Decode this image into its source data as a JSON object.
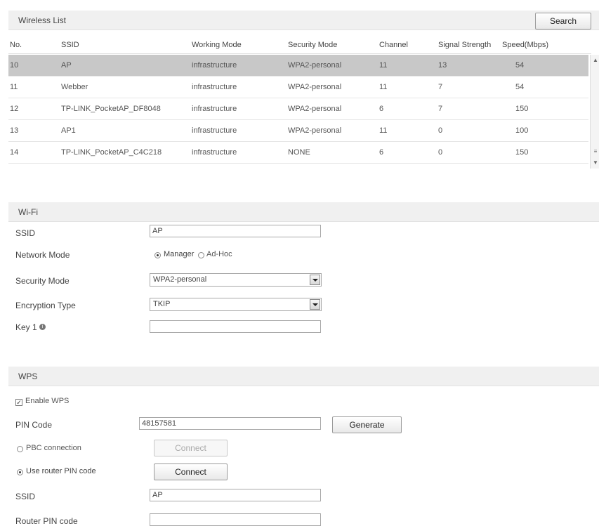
{
  "wireless_list": {
    "title": "Wireless List",
    "search_label": "Search",
    "columns": [
      "No.",
      "SSID",
      "Working Mode",
      "Security Mode",
      "Channel",
      "Signal Strength",
      "Speed(Mbps)"
    ],
    "rows": [
      [
        "10",
        "AP",
        "infrastructure",
        "WPA2-personal",
        "11",
        "13",
        "54"
      ],
      [
        "11",
        "Webber",
        "infrastructure",
        "WPA2-personal",
        "11",
        "7",
        "54"
      ],
      [
        "12",
        "TP-LINK_PocketAP_DF8048",
        "infrastructure",
        "WPA2-personal",
        "6",
        "7",
        "150"
      ],
      [
        "13",
        "AP1",
        "infrastructure",
        "WPA2-personal",
        "11",
        "0",
        "100"
      ],
      [
        "14",
        "TP-LINK_PocketAP_C4C218",
        "infrastructure",
        "NONE",
        "6",
        "0",
        "150"
      ]
    ]
  },
  "wifi": {
    "title": "Wi-Fi",
    "ssid_label": "SSID",
    "ssid_value": "AP",
    "network_mode_label": "Network Mode",
    "mode_manager": "Manager",
    "mode_adhoc": "Ad-Hoc",
    "security_mode_label": "Security Mode",
    "security_mode_value": "WPA2-personal",
    "encryption_type_label": "Encryption Type",
    "encryption_type_value": "TKIP",
    "key1_label": "Key 1",
    "key1_value": ""
  },
  "wps": {
    "title": "WPS",
    "enable_label": "Enable WPS",
    "pin_code_label": "PIN Code",
    "pin_code_value": "48157581",
    "generate_label": "Generate",
    "pbc_label": "PBC connection",
    "connect_label": "Connect",
    "use_router_pin_label": "Use router PIN code",
    "ssid_label": "SSID",
    "ssid_value": "AP",
    "router_pin_label": "Router PIN code",
    "router_pin_value": ""
  }
}
